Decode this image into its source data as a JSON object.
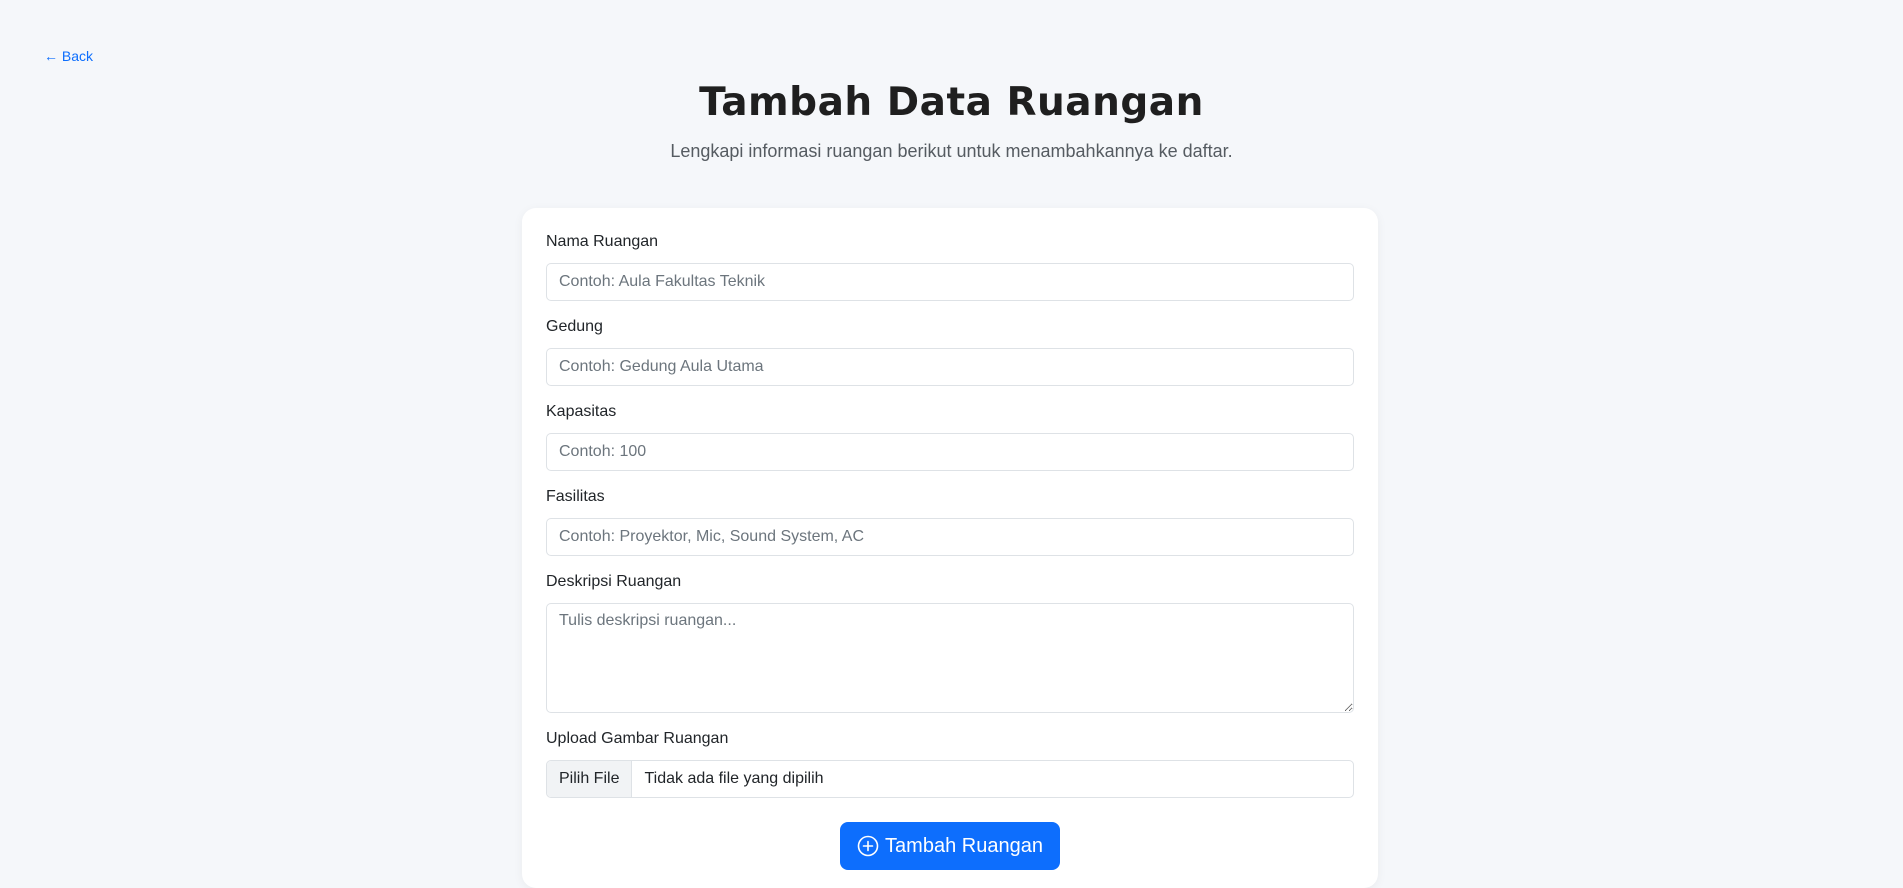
{
  "nav": {
    "back_label": "← Back"
  },
  "header": {
    "title": "Tambah Data Ruangan",
    "subtitle": "Lengkapi informasi ruangan berikut untuk menambahkannya ke daftar."
  },
  "form": {
    "nama": {
      "label": "Nama Ruangan",
      "placeholder": "Contoh: Aula Fakultas Teknik"
    },
    "gedung": {
      "label": "Gedung",
      "placeholder": "Contoh: Gedung Aula Utama"
    },
    "kapasitas": {
      "label": "Kapasitas",
      "placeholder": "Contoh: 100"
    },
    "fasilitas": {
      "label": "Fasilitas",
      "placeholder": "Contoh: Proyektor, Mic, Sound System, AC"
    },
    "deskripsi": {
      "label": "Deskripsi Ruangan",
      "placeholder": "Tulis deskripsi ruangan..."
    },
    "upload": {
      "label": "Upload Gambar Ruangan",
      "button_label": "Pilih File",
      "status": "Tidak ada file yang dipilih"
    },
    "submit": {
      "label": "Tambah Ruangan",
      "icon": "plus-circle-icon"
    }
  },
  "colors": {
    "accent": "#0d6efd",
    "background": "#f5f7fa",
    "card": "#ffffff"
  }
}
